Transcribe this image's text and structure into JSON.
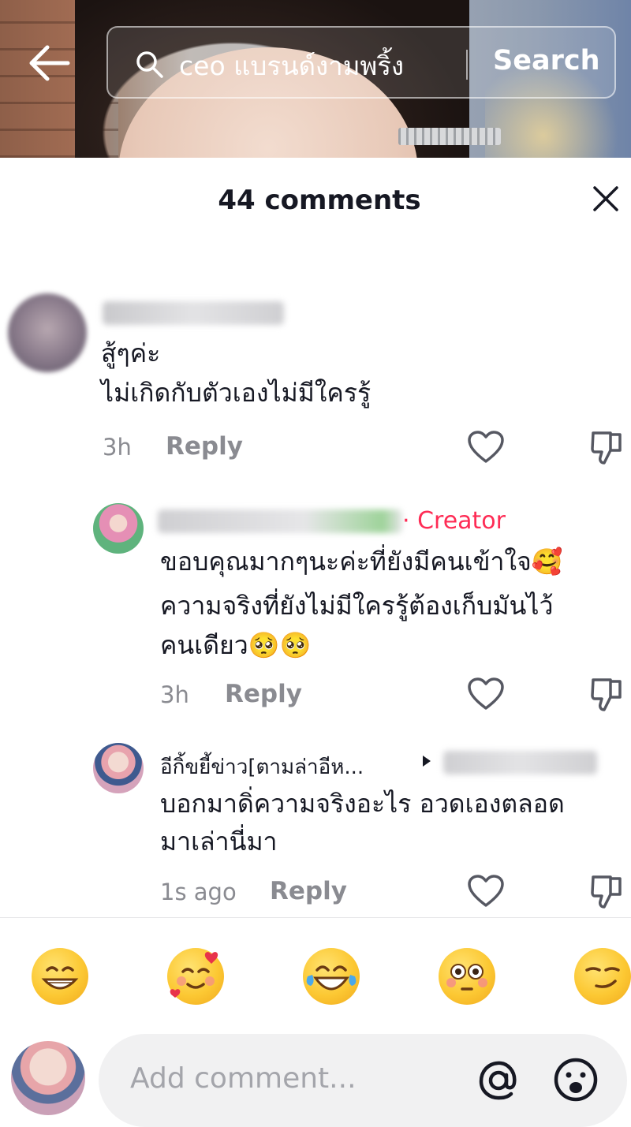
{
  "header": {
    "search_query": "ceo แบรนด์งามพริ้ง",
    "search_button": "Search"
  },
  "panel": {
    "title": "44 comments"
  },
  "comments": [
    {
      "lines": [
        "สู้ๆค่ะ",
        "ไม่เกิดกับตัวเองไม่มีใครรู้"
      ],
      "time": "3h",
      "reply_label": "Reply"
    },
    {
      "badge": "Creator",
      "lines": [
        "ขอบคุณมากๆนะค่ะที่ยังมีคนเข้าใจ🥰",
        "ความจริงที่ยังไม่มีใครรู้ต้องเก็บมันไว้",
        "คนเดียว🥺🥺"
      ],
      "time": "3h",
      "reply_label": "Reply"
    },
    {
      "username": "อีกิ้ขยี้ข่าว[ตามล่าอีห...",
      "lines": [
        "บอกมาดิ่ความจริงอะไร อวดเองตลอด",
        "มาเล่านี่มา"
      ],
      "time": "1s ago",
      "reply_label": "Reply"
    }
  ],
  "emoji_bar": [
    "grin-emoji",
    "smiling-hearts-emoji",
    "tears-of-joy-emoji",
    "flushed-emoji",
    "smirk-emoji"
  ],
  "input": {
    "placeholder": "Add comment..."
  },
  "colors": {
    "accent": "#fe2c55",
    "muted": "#8a8b91",
    "text": "#161823"
  }
}
